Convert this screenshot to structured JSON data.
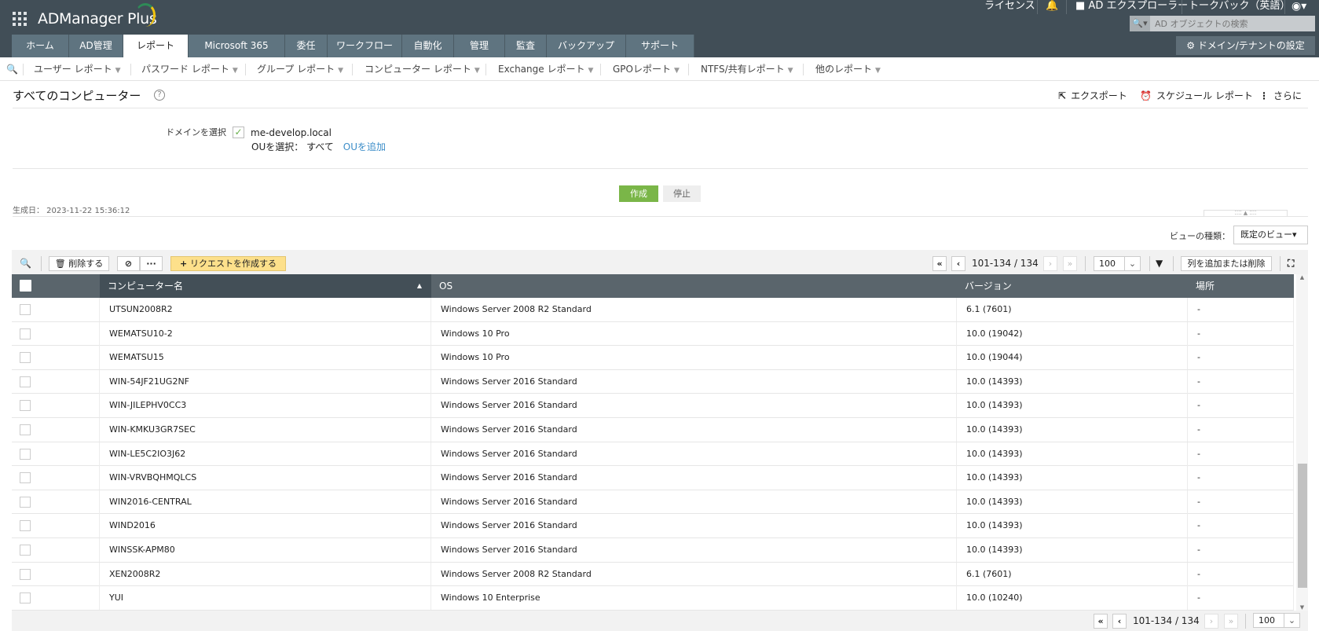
{
  "app": {
    "name": "ADManager Plus"
  },
  "top_links": {
    "license": "ライセンス",
    "ad_explorer": "AD エクスプローラー",
    "talkback": "トークバック（英語）"
  },
  "search": {
    "placeholder": "AD オブジェクトの検索"
  },
  "domain_settings": "ドメイン/テナントの設定",
  "tabs": [
    "ホーム",
    "AD管理",
    "レポート",
    "Microsoft 365",
    "委任",
    "ワークフロー",
    "自動化",
    "管理",
    "監査",
    "バックアップ",
    "サポート"
  ],
  "menu": [
    "ユーザー レポート",
    "パスワード レポート",
    "グループ レポート",
    "コンピューター レポート",
    "Exchange レポート",
    "GPOレポート",
    "NTFS/共有レポート",
    "他のレポート"
  ],
  "page": {
    "title": "すべてのコンピューター",
    "export": "エクスポート",
    "schedule": "スケジュール レポート",
    "more": "さらに"
  },
  "form": {
    "domain_label": "ドメインを選択",
    "domain": "me-develop.local",
    "ou_label": "OUを選択：",
    "ou_value": "すべて",
    "add_ou": "OUを追加",
    "create": "作成",
    "stop": "停止"
  },
  "generated": "生成日： 2023-11-22 15:36:12",
  "view": {
    "label": "ビューの種類：",
    "value": "既定のビュー▾"
  },
  "toolbar": {
    "delete": "削除する",
    "request": "リクエストを作成する",
    "range": "101-134 / 134",
    "page_size": "100",
    "columns": "列を追加または削除"
  },
  "columns": [
    "コンピューター名",
    "OS",
    "バージョン",
    "場所"
  ],
  "rows": [
    [
      "UTSUN2008R2",
      "Windows Server 2008 R2 Standard",
      "6.1 (7601)",
      "-"
    ],
    [
      "WEMATSU10-2",
      "Windows 10 Pro",
      "10.0 (19042)",
      "-"
    ],
    [
      "WEMATSU15",
      "Windows 10 Pro",
      "10.0 (19044)",
      "-"
    ],
    [
      "WIN-54JF21UG2NF",
      "Windows Server 2016 Standard",
      "10.0 (14393)",
      "-"
    ],
    [
      "WIN-JILEPHV0CC3",
      "Windows Server 2016 Standard",
      "10.0 (14393)",
      "-"
    ],
    [
      "WIN-KMKU3GR7SEC",
      "Windows Server 2016 Standard",
      "10.0 (14393)",
      "-"
    ],
    [
      "WIN-LE5C2IO3J62",
      "Windows Server 2016 Standard",
      "10.0 (14393)",
      "-"
    ],
    [
      "WIN-VRVBQHMQLCS",
      "Windows Server 2016 Standard",
      "10.0 (14393)",
      "-"
    ],
    [
      "WIN2016-CENTRAL",
      "Windows Server 2016 Standard",
      "10.0 (14393)",
      "-"
    ],
    [
      "WIND2016",
      "Windows Server 2016 Standard",
      "10.0 (14393)",
      "-"
    ],
    [
      "WINSSK-APM80",
      "Windows Server 2016 Standard",
      "10.0 (14393)",
      "-"
    ],
    [
      "XEN2008R2",
      "Windows Server 2008 R2 Standard",
      "6.1 (7601)",
      "-"
    ],
    [
      "YUI",
      "Windows 10 Enterprise",
      "10.0 (10240)",
      "-"
    ]
  ]
}
